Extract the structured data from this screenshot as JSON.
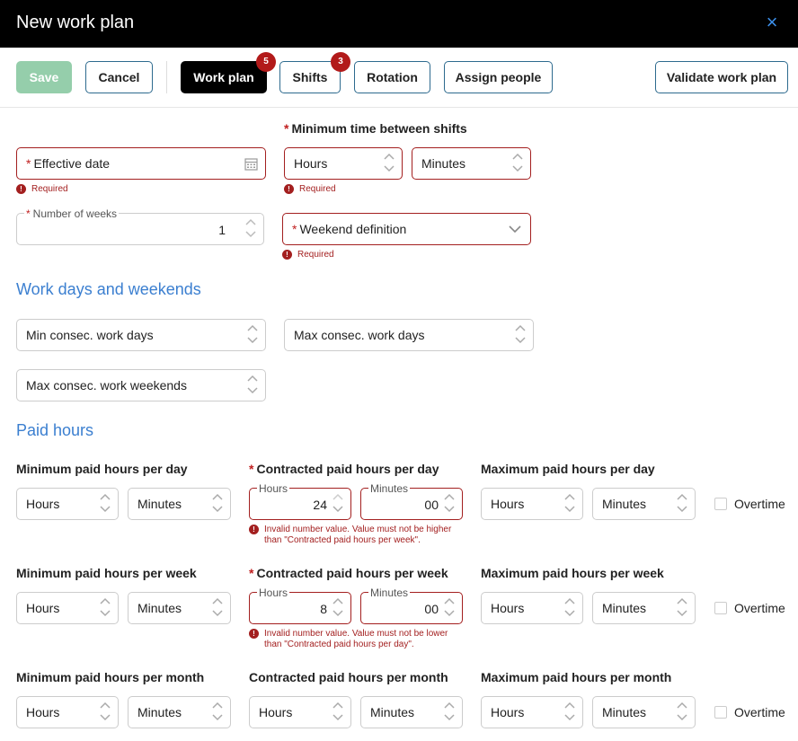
{
  "window": {
    "title": "New work plan",
    "close_icon": "×"
  },
  "toolbar": {
    "save": "Save",
    "cancel": "Cancel",
    "work_plan": "Work plan",
    "work_plan_badge": "5",
    "shifts": "Shifts",
    "shifts_badge": "3",
    "rotation": "Rotation",
    "assign_people": "Assign people",
    "validate": "Validate work plan"
  },
  "form": {
    "effective_date": "Effective date",
    "required": "Required",
    "number_of_weeks_label": "Number of weeks",
    "number_of_weeks_value": "1",
    "min_time_between_shifts": "Minimum time between shifts",
    "hours": "Hours",
    "minutes": "Minutes",
    "weekend_definition": "Weekend definition",
    "star": "*"
  },
  "work_days": {
    "title": "Work days and weekends",
    "min_consec_work_days": "Min consec. work days",
    "max_consec_work_days": "Max consec. work days",
    "max_consec_work_weekends": "Max consec. work weekends"
  },
  "paid_hours": {
    "title": "Paid hours",
    "overtime": "Overtime",
    "day": {
      "min": "Minimum paid hours per day",
      "contracted": "Contracted paid hours per day",
      "max": "Maximum paid hours per day",
      "contracted_hours": "24",
      "contracted_minutes": "00",
      "error": "Invalid number value. Value must not be higher than \"Contracted paid hours per week\"."
    },
    "week": {
      "min": "Minimum paid hours per week",
      "contracted": "Contracted paid hours per week",
      "max": "Maximum paid hours per week",
      "contracted_hours": "8",
      "contracted_minutes": "00",
      "error": "Invalid number value. Value must not be lower than \"Contracted paid hours per day\"."
    },
    "month": {
      "min": "Minimum paid hours per month",
      "contracted": "Contracted paid hours per month",
      "max": "Maximum paid hours per month"
    }
  },
  "colors": {
    "accent": "#3b7fd0",
    "error": "#a31f1f",
    "save": "#95ceab",
    "active_tab": "#000000"
  }
}
